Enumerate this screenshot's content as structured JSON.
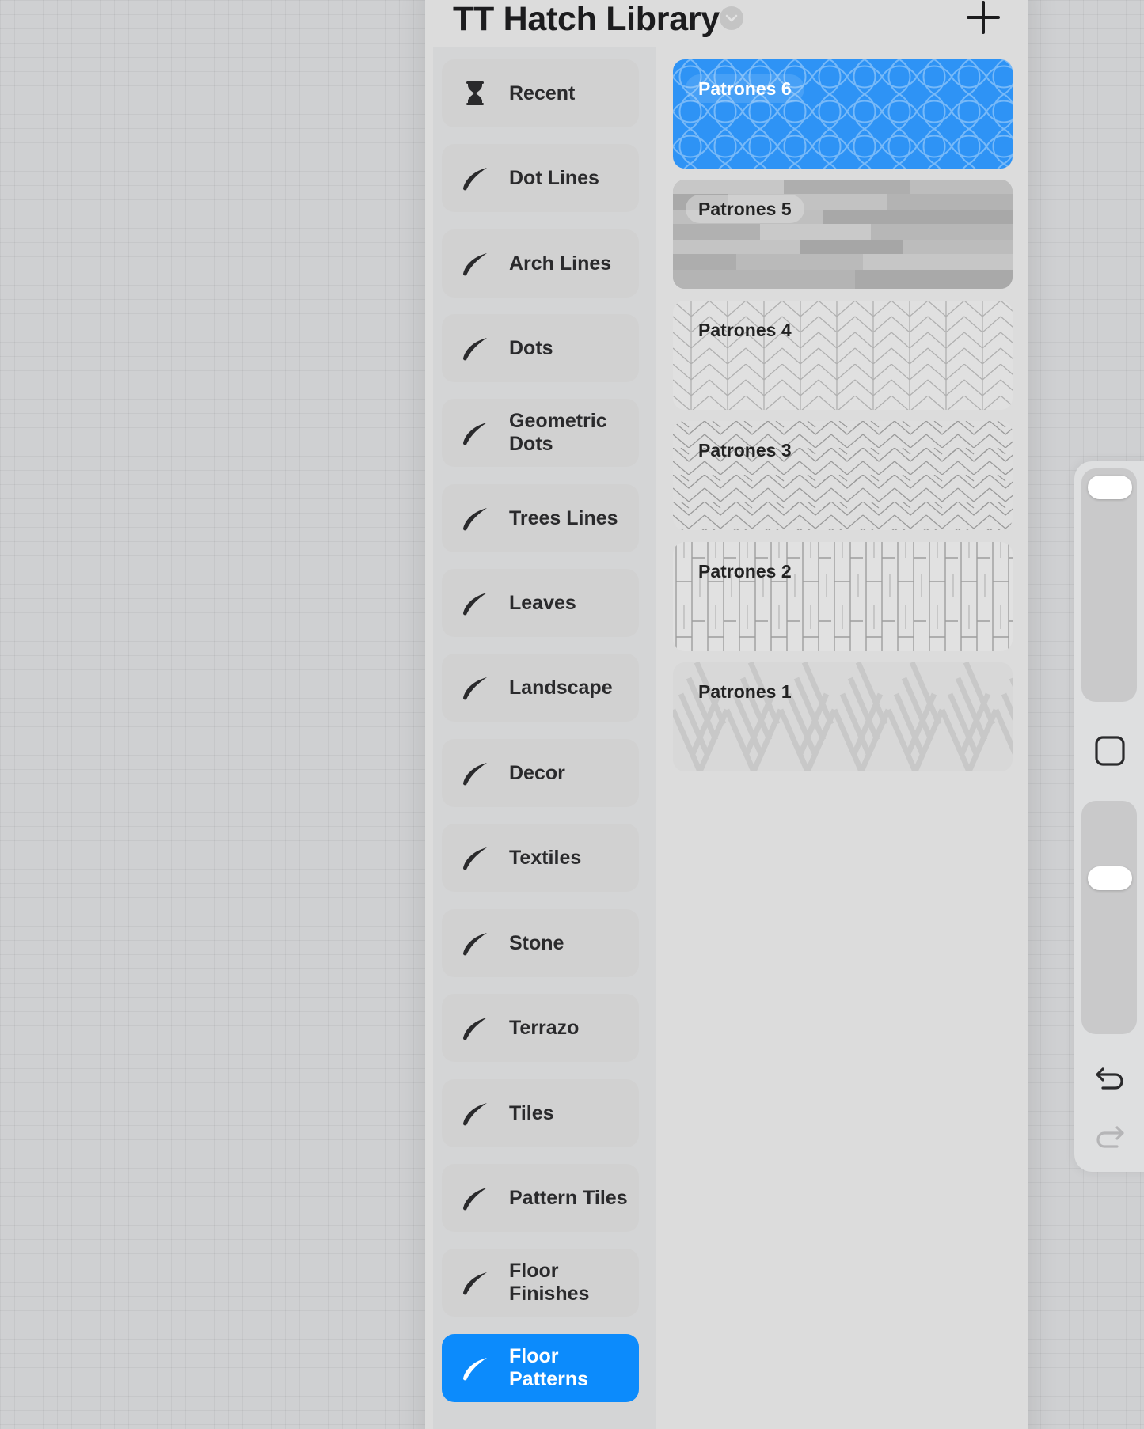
{
  "library": {
    "title": "TT Hatch Library",
    "add_icon": "plus-icon",
    "dropdown_icon": "chevron-down-icon"
  },
  "sets": [
    {
      "label": "Recent",
      "icon": "hourglass-icon",
      "active": false
    },
    {
      "label": "Dot Lines",
      "icon": "brush-stroke-icon",
      "active": false
    },
    {
      "label": "Arch Lines",
      "icon": "brush-stroke-icon",
      "active": false
    },
    {
      "label": "Dots",
      "icon": "brush-stroke-icon",
      "active": false
    },
    {
      "label": "Geometric Dots",
      "icon": "brush-stroke-icon",
      "active": false
    },
    {
      "label": "Trees Lines",
      "icon": "brush-stroke-icon",
      "active": false
    },
    {
      "label": "Leaves",
      "icon": "brush-stroke-icon",
      "active": false
    },
    {
      "label": "Landscape",
      "icon": "brush-stroke-icon",
      "active": false
    },
    {
      "label": "Decor",
      "icon": "brush-stroke-icon",
      "active": false
    },
    {
      "label": "Textiles",
      "icon": "brush-stroke-icon",
      "active": false
    },
    {
      "label": "Stone",
      "icon": "brush-stroke-icon",
      "active": false
    },
    {
      "label": "Terrazo",
      "icon": "brush-stroke-icon",
      "active": false
    },
    {
      "label": "Tiles",
      "icon": "brush-stroke-icon",
      "active": false
    },
    {
      "label": "Pattern Tiles",
      "icon": "brush-stroke-icon",
      "active": false
    },
    {
      "label": "Floor Finishes",
      "icon": "brush-stroke-icon",
      "active": false
    },
    {
      "label": "Floor Patterns",
      "icon": "brush-stroke-icon",
      "active": true
    }
  ],
  "brushes": [
    {
      "name": "Patrones 6",
      "selected": true
    },
    {
      "name": "Patrones 5",
      "selected": false
    },
    {
      "name": "Patrones 4",
      "selected": false
    },
    {
      "name": "Patrones 3",
      "selected": false
    },
    {
      "name": "Patrones 2",
      "selected": false
    },
    {
      "name": "Patrones 1",
      "selected": false
    }
  ],
  "sidebar": {
    "size_slider_icon": "size-slider",
    "square_icon": "modify-square-icon",
    "undo_icon": "undo-icon",
    "redo_icon": "redo-icon"
  },
  "colors": {
    "accent": "#0c8bfc",
    "panel": "#dcdcdc",
    "canvas": "#cfd0d2"
  }
}
